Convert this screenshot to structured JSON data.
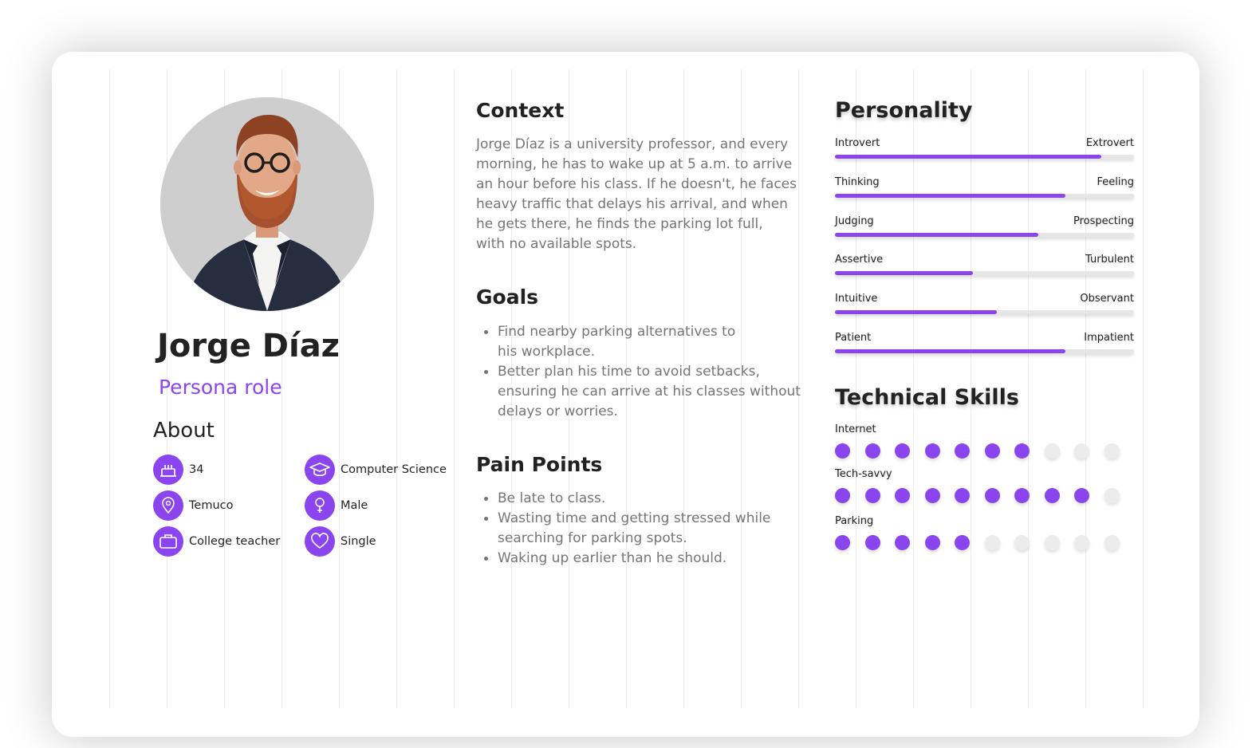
{
  "persona": {
    "name": "Jorge Díaz",
    "role": "Persona role",
    "photo_icon": "person-photo"
  },
  "about": {
    "title": "About",
    "items": [
      {
        "icon": "cake-icon",
        "text": "34"
      },
      {
        "icon": "graduation-cap-icon",
        "text": "Computer Science"
      },
      {
        "icon": "location-pin-icon",
        "text": "Temuco"
      },
      {
        "icon": "male-icon",
        "text": "Male"
      },
      {
        "icon": "briefcase-icon",
        "text": "College teacher"
      },
      {
        "icon": "heart-icon",
        "text": "Single"
      }
    ]
  },
  "context": {
    "title": "Context",
    "lines": [
      "Jorge Díaz is a university professor, and every",
      "morning, he has to wake up at 5 a.m. to arrive",
      "an hour before his class. If he doesn't, he faces",
      "heavy traffic that delays his arrival, and when",
      "he gets there, he finds the parking lot full,",
      "with no available spots."
    ]
  },
  "goals": {
    "title": "Goals",
    "items": [
      "Find nearby parking alternatives to his workplace.",
      "Better plan his time to avoid setbacks, ensuring he can arrive at his classes without delays or worries."
    ]
  },
  "pain_points": {
    "title": "Pain Points",
    "items": [
      "Be late to class.",
      "Wasting time and getting stressed while searching for parking spots.",
      "Waking up earlier than he should."
    ]
  },
  "personality": {
    "title": "Personality",
    "traits": [
      {
        "left": "Introvert",
        "right": "Extrovert",
        "value": 0.89
      },
      {
        "left": "Thinking",
        "right": "Feeling",
        "value": 0.77
      },
      {
        "left": "Judging",
        "right": "Prospecting",
        "value": 0.68
      },
      {
        "left": "Assertive",
        "right": "Turbulent",
        "value": 0.46
      },
      {
        "left": "Intuitive",
        "right": "Observant",
        "value": 0.54
      },
      {
        "left": "Patient",
        "right": "Impatient",
        "value": 0.77
      }
    ]
  },
  "skills": {
    "title": "Technical Skills",
    "max": 10,
    "items": [
      {
        "label": "Internet",
        "level": 7
      },
      {
        "label": "Tech-savvy",
        "level": 9
      },
      {
        "label": "Parking",
        "level": 5
      }
    ]
  },
  "colors": {
    "accent": "#8b45ee",
    "track": "#e6e6e6",
    "text": "#222222",
    "muted": "#757575"
  }
}
